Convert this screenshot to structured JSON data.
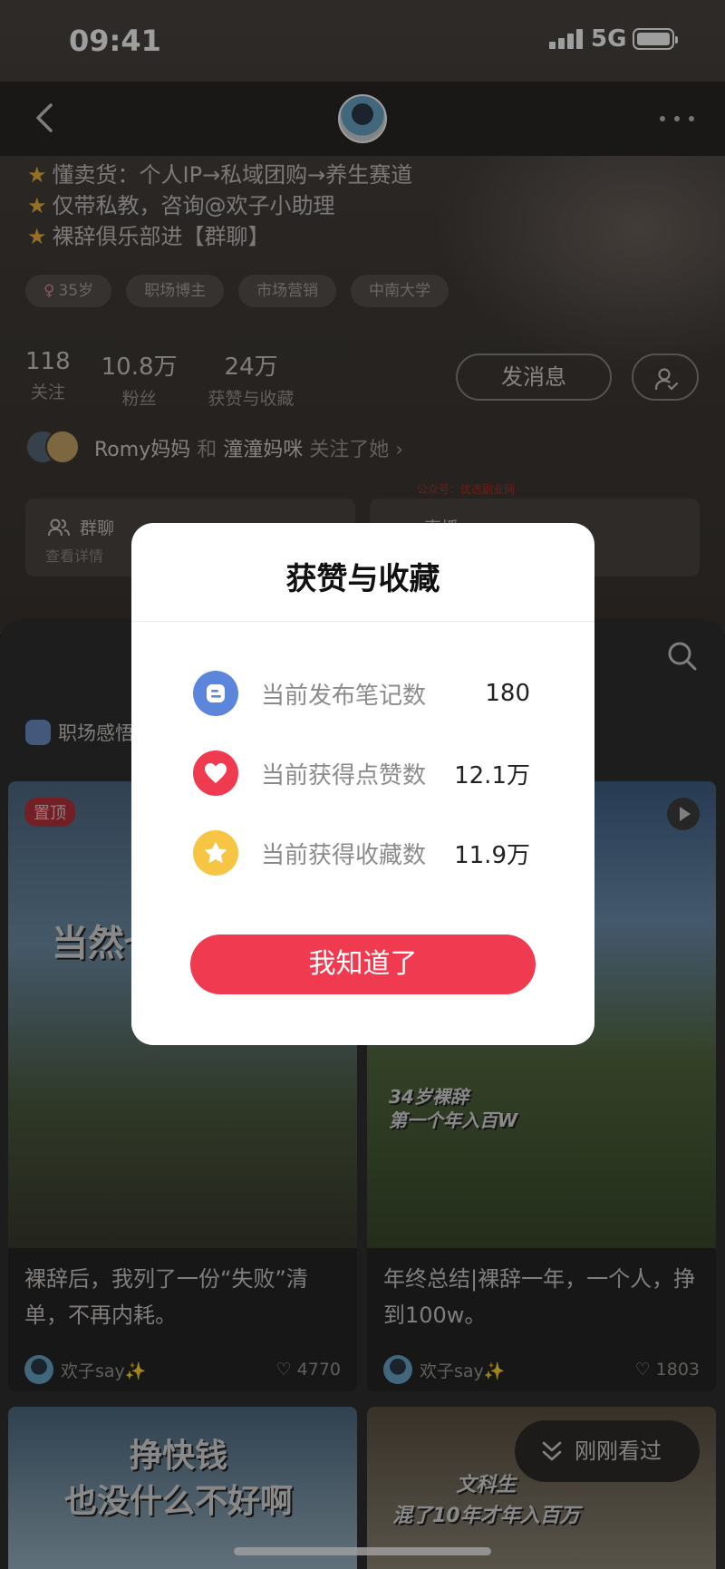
{
  "status_bar": {
    "time": "09:41",
    "network": "5G"
  },
  "profile": {
    "bio": [
      "懂卖货：个人IP→私域团购→养生赛道",
      "仅带私教，咨询@欢子小助理",
      "裸辞俱乐部进【群聊】"
    ],
    "tags": {
      "age": "35岁",
      "t1": "职场博主",
      "t2": "市场营销",
      "t3": "中南大学"
    },
    "stats": {
      "following_num": "118",
      "following_label": "关注",
      "fans_num": "10.8万",
      "fans_label": "粉丝",
      "likes_num": "24万",
      "likes_label": "获赞与收藏"
    },
    "message_button": "发消息",
    "mutual": {
      "name1": "Romy妈妈",
      "and": "和",
      "name2": "潼潼妈咪",
      "suffix": "关注了她"
    },
    "watermark": "公众号：优选副业网",
    "group_card": {
      "title": "群聊",
      "sub": "查看详情"
    },
    "live_card": {
      "title": "直播"
    }
  },
  "feed": {
    "category": "职场感悟",
    "posts": [
      {
        "title": "裸辞后，我列了一份“失败”清单，不再内耗。",
        "author": "欢子say✨",
        "likes": "4770",
        "badge": "置顶",
        "caption": "当然也"
      },
      {
        "title": "年终总结|裸辞一年，一个人，挣到100w。",
        "author": "欢子say✨",
        "likes": "1803",
        "caption": "34岁裸辞\n第一个年入百W"
      }
    ],
    "bottom_captions": {
      "left": "挣快钱\n也没什么不好啊",
      "right": "文科生\n混了10年才年入百万"
    },
    "recent_pill": "刚刚看过"
  },
  "modal": {
    "title": "获赞与收藏",
    "rows": [
      {
        "label": "当前发布笔记数",
        "value": "180",
        "icon": "note-icon",
        "color": "#5b86dc"
      },
      {
        "label": "当前获得点赞数",
        "value": "12.1万",
        "icon": "heart-icon",
        "color": "#ef3a4f"
      },
      {
        "label": "当前获得收藏数",
        "value": "11.9万",
        "icon": "star-icon",
        "color": "#f6c544"
      }
    ],
    "confirm_button": "我知道了"
  }
}
